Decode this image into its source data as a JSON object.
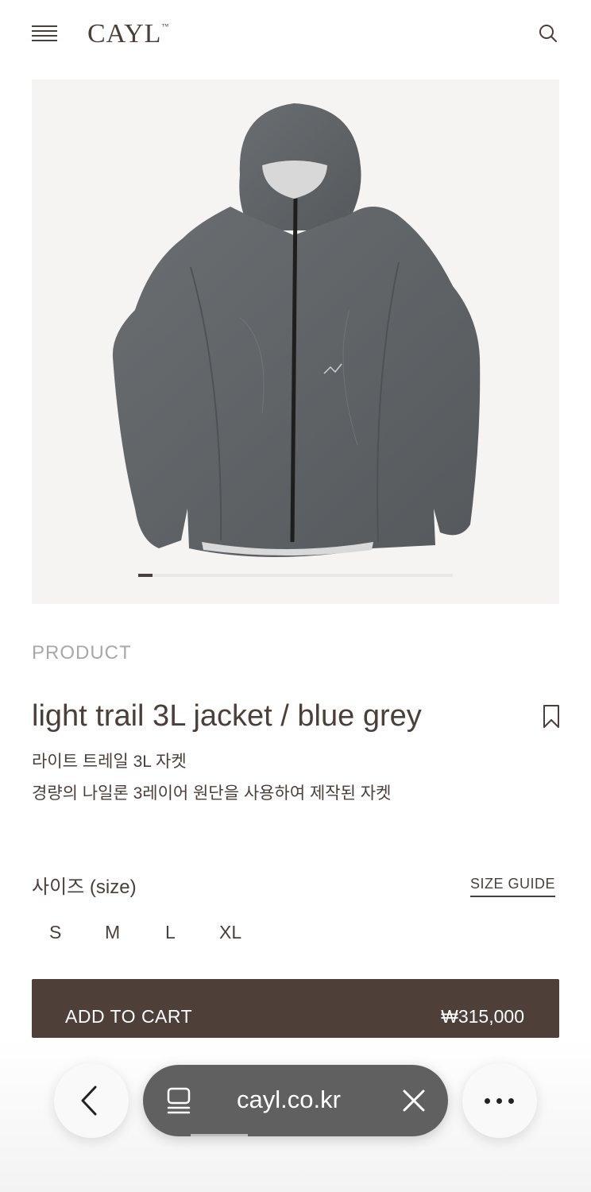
{
  "header": {
    "logo": "CAYL",
    "logo_mark": "™",
    "icons": {
      "menu": "hamburger-icon",
      "search": "search-icon"
    }
  },
  "gallery": {
    "image_alt": "light trail 3L jacket / blue grey",
    "current_slide": 1,
    "product_color": "#5f6366"
  },
  "product": {
    "category": "PRODUCT",
    "title": "light trail 3L jacket / blue grey",
    "subtitle_ko": "라이트 트레일 3L 자켓",
    "description_ko": "경량의 나일론 3레이어 원단을 사용하여 제작된 자켓",
    "bookmark_icon": "bookmark-icon"
  },
  "size": {
    "label": "사이즈 (size)",
    "guide_label": "SIZE GUIDE",
    "options": [
      "S",
      "M",
      "L",
      "XL"
    ]
  },
  "cart": {
    "label": "ADD TO CART",
    "price": "₩315,000"
  },
  "browser": {
    "url": "cayl.co.kr",
    "icons": {
      "back": "chevron-left-icon",
      "tabs": "tabs-icon",
      "close": "close-icon",
      "more": "more-icon"
    }
  },
  "colors": {
    "brand": "#4a3f39",
    "cart_bg": "#4e3f39",
    "muted": "#a8a8a8",
    "url_pill": "#606060"
  }
}
